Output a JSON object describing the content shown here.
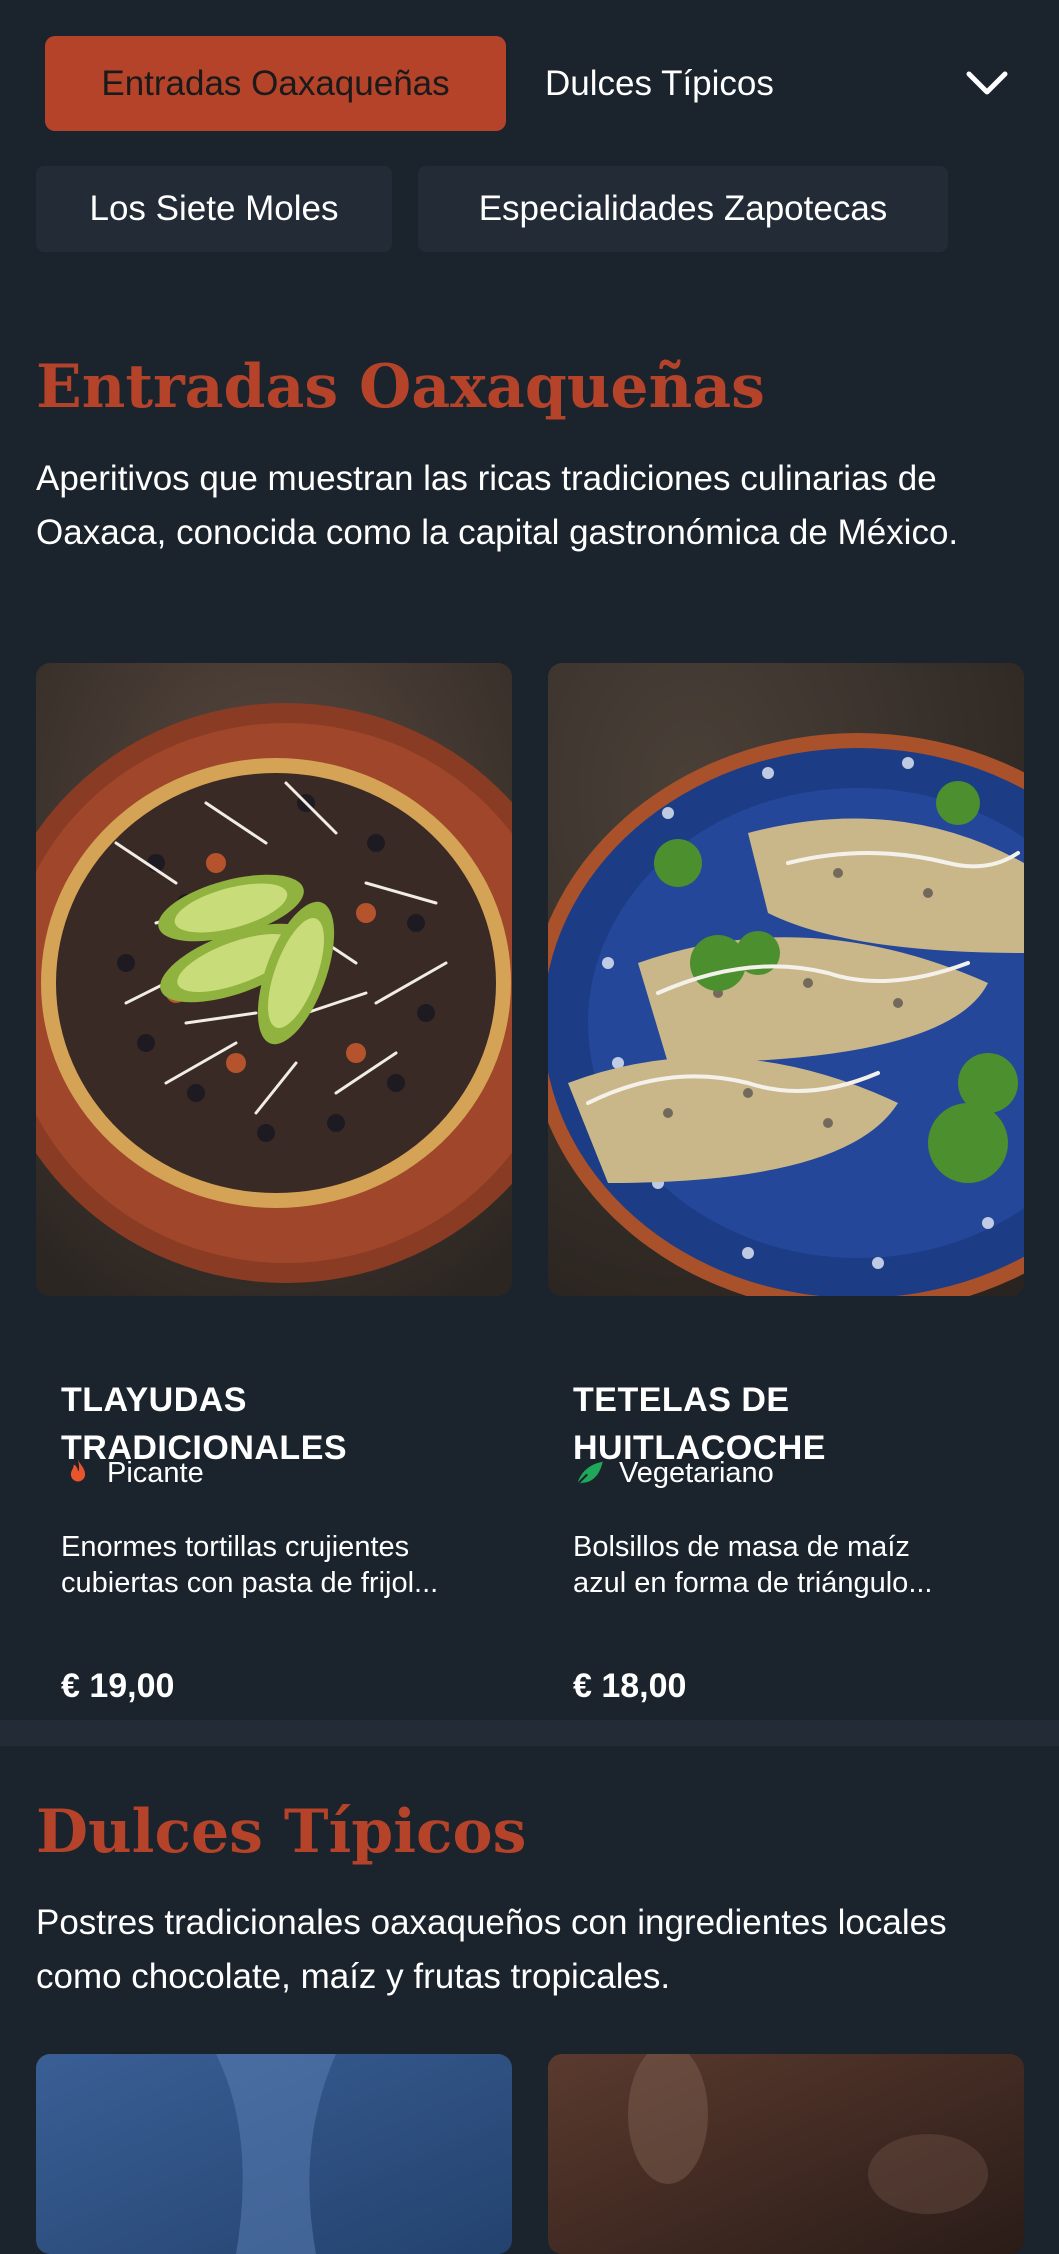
{
  "nav": {
    "active_tab": "Entradas Oaxaqueñas",
    "tab_2": "Dulces Típicos",
    "dropdown_icon": "chevron-down-icon",
    "sub_tabs": [
      "Los Siete Moles",
      "Especialidades Zapotecas"
    ]
  },
  "sections": [
    {
      "title": "Entradas Oaxaqueñas",
      "description": "Aperitivos que muestran las ricas tradiciones culinarias de Oaxaca, conocida como la capital gastronómica de México.",
      "items": [
        {
          "name": "TLAYUDAS TRADICIONALES",
          "tag": "Picante",
          "tag_icon": "flame-icon",
          "tag_color": "#e8552d",
          "description_line_1": "Enormes tortillas crujientes",
          "description_line_2": "cubiertas con pasta de frijol...",
          "price": "€ 19,00"
        },
        {
          "name": "TETELAS DE HUITLACOCHE",
          "tag": "Vegetariano",
          "tag_icon": "leaf-icon",
          "tag_color": "#1fa85a",
          "description_line_1": "Bolsillos de masa de maíz",
          "description_line_2": "azul en forma de triángulo...",
          "price": "€ 18,00"
        }
      ]
    },
    {
      "title": "Dulces Típicos",
      "description": "Postres tradicionales oaxaqueños con ingredientes locales como chocolate, maíz y frutas tropicales."
    }
  ],
  "colors": {
    "background": "#1b232d",
    "accent": "#b5432a",
    "surface": "#222b36"
  }
}
